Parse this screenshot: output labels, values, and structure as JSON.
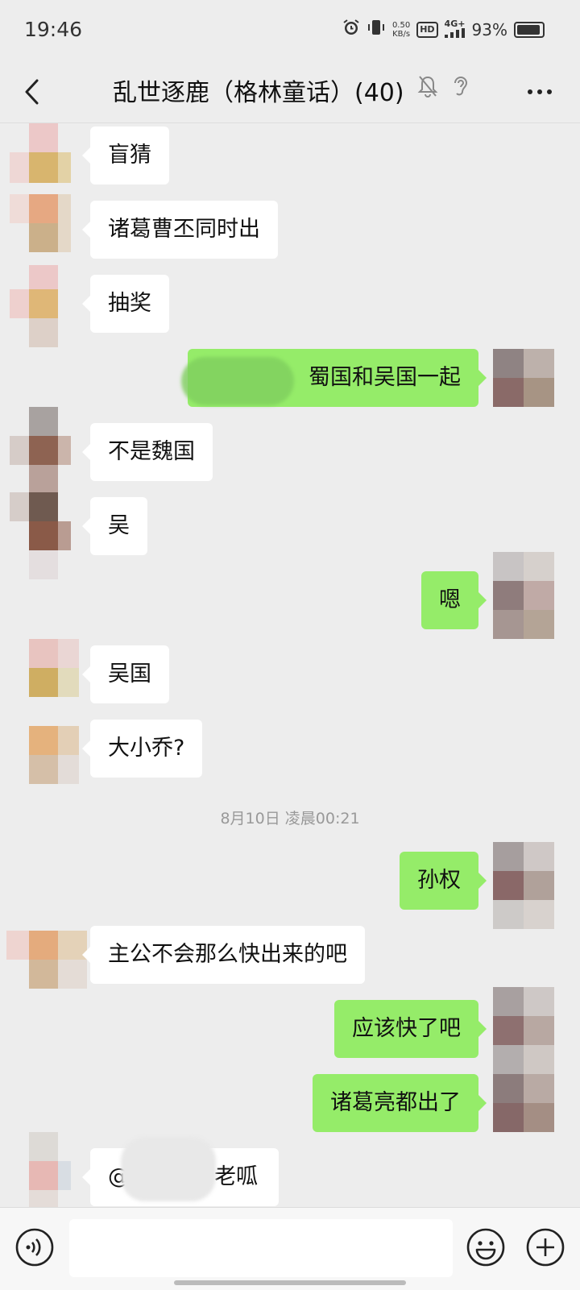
{
  "status_bar": {
    "time": "19:46",
    "speed_value": "0.50",
    "speed_unit": "KB/s",
    "hd": "HD",
    "network": "4G+",
    "battery": "93%",
    "icons": [
      "alarm-icon",
      "vibrate-icon",
      "signal-icon",
      "battery-icon"
    ]
  },
  "header": {
    "title": "乱世逐鹿（格林童话）(40)",
    "icons": [
      "back-icon",
      "mute-bell-icon",
      "ear-icon",
      "more-icon"
    ]
  },
  "messages": [
    {
      "side": "left",
      "text": "盲猜"
    },
    {
      "side": "left",
      "text": "诸葛曹丕同时出"
    },
    {
      "side": "left",
      "text": "抽奖"
    },
    {
      "side": "right",
      "text": "蜀国和吴国一起"
    },
    {
      "side": "left",
      "text": "不是魏国"
    },
    {
      "side": "left",
      "text": "吴"
    },
    {
      "side": "right",
      "text": "嗯"
    },
    {
      "side": "left",
      "text": "吴国"
    },
    {
      "side": "left",
      "text": "大小乔?"
    },
    {
      "side": "right",
      "text": "孙权"
    },
    {
      "side": "left",
      "text": "主公不会那么快出来的吧"
    },
    {
      "side": "right",
      "text": "应该快了吧"
    },
    {
      "side": "right",
      "text": "诸葛亮都出了"
    },
    {
      "side": "left",
      "text_prefix": "@",
      "text_suffix": "老呱"
    }
  ],
  "timestamp": "8月10日 凌晨00:21",
  "input_bar": {
    "input_value": "",
    "icons": [
      "voice-icon",
      "emoji-icon",
      "plus-icon"
    ]
  },
  "colors": {
    "background": "#ededed",
    "my_bubble": "#95ec69",
    "other_bubble": "#ffffff"
  }
}
